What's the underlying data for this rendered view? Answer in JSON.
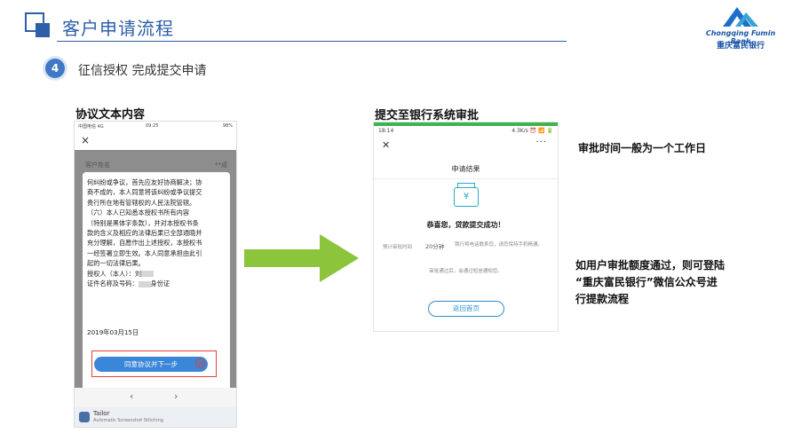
{
  "header": {
    "title": "客户申请流程",
    "logo_en": "Chongqing Fumin Bank",
    "logo_cn": "重庆富民银行"
  },
  "step": {
    "number": "4",
    "text": "征信授权 完成提交申请"
  },
  "left_caption": "协议文本内容",
  "right_caption": "提交至银行系统审批",
  "left_phone": {
    "status_carrier": "中国电信 4G",
    "status_time": "09:25",
    "status_right": "98%",
    "close_icon": "×",
    "customer_label": "客户姓名",
    "customer_value": "**成",
    "agreement_lines": [
      "何纠纷或争议，首先应友好协商解决；协",
      "商不成的，本人同意将该纠纷或争议提交",
      "贵行所在地有管辖权的人民法院管辖。",
      "（六）本人已知悉本授权书所有内容",
      "（特别是黑体字条款），并对本授权书条",
      "款的含义及相应的法律后果已全部通晓并",
      "充分理解，自愿作出上述授权，本授权书",
      "一经签署立即生效。本人同意承担由此引",
      "起的一切法律后果。"
    ],
    "authorizer_label": "授权人（本人）：",
    "authorizer_value": "刘",
    "id_label": "证件名称及号码：",
    "id_value": "身份证",
    "date": "2019年03月15日",
    "agree_button": "同意协议并下一步",
    "annotation": "②",
    "nav_back": "‹",
    "nav_forward": "›",
    "tailor_name": "Tailor",
    "tailor_sub": "Automatic Screenshot Stitching"
  },
  "right_phone": {
    "status_time": "18:14",
    "status_right": "4.3K/s ⏰ 📶 🔋",
    "close_icon": "✕",
    "more_icon": "···",
    "page_title": "申请结果",
    "success_text": "恭喜您，贷款提交成功！",
    "estimate_label": "预计审批时间",
    "estimate_value": "20分钟",
    "estimate_note": "我行将电话联系您，请您保持手机畅通。",
    "result_note": "审批通过后，会通过短信通知您。",
    "home_button": "返回首页"
  },
  "notes": {
    "approval_time": "审批时间一般为一个工作日",
    "if_approved_lines": [
      "如用户审批额度通过，则可登陆",
      "“重庆富民银行”微信公众号进",
      "行提款流程"
    ]
  },
  "colors": {
    "primary_blue": "#2d5ea8",
    "arrow_green": "#8cc43c",
    "button_blue": "#3a86d8",
    "highlight_red": "#e0403c"
  }
}
